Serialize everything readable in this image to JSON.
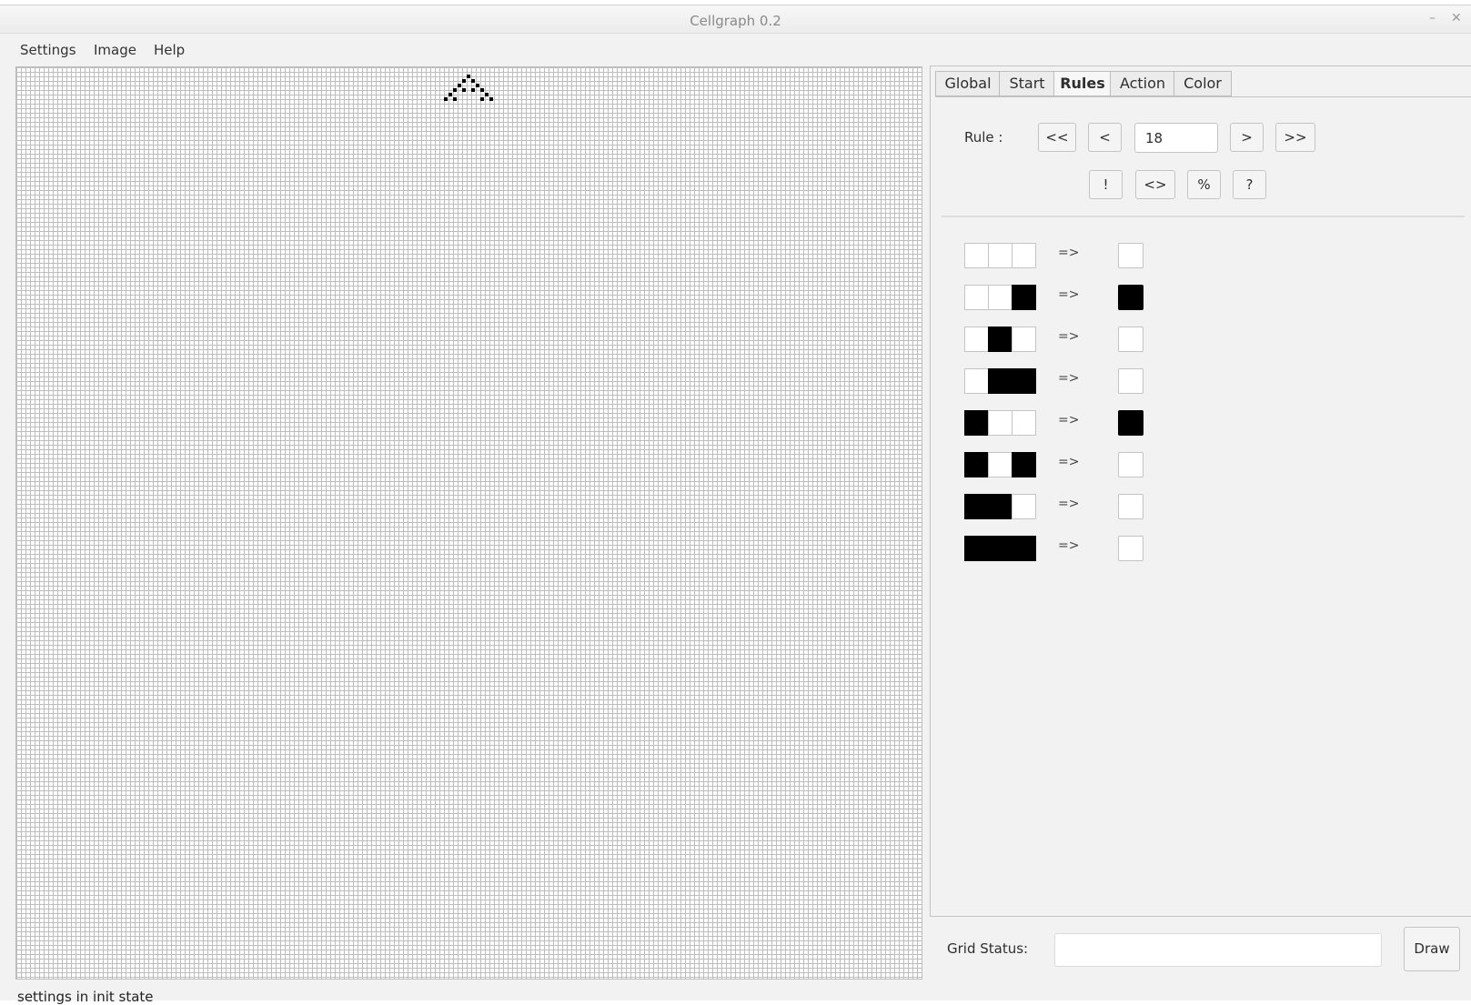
{
  "window": {
    "title": "Cellgraph 0.2",
    "minimize_glyph": "–",
    "close_glyph": "✕"
  },
  "menubar": {
    "items": [
      "Settings",
      "Image",
      "Help"
    ]
  },
  "tabs": [
    {
      "label": "Global",
      "active": false
    },
    {
      "label": "Start",
      "active": false
    },
    {
      "label": "Rules",
      "active": true
    },
    {
      "label": "Action",
      "active": false
    },
    {
      "label": "Color",
      "active": false
    }
  ],
  "rules": {
    "label": "Rule :",
    "value": "18",
    "nav_buttons": {
      "first": "<<",
      "prev": "<",
      "next": ">",
      "last": ">>"
    },
    "op_buttons": [
      "!",
      "<>",
      "%",
      "?"
    ],
    "arrow": "=>",
    "table": [
      {
        "pattern": [
          0,
          0,
          0
        ],
        "result": 0
      },
      {
        "pattern": [
          0,
          0,
          1
        ],
        "result": 1
      },
      {
        "pattern": [
          0,
          1,
          0
        ],
        "result": 0
      },
      {
        "pattern": [
          0,
          1,
          1
        ],
        "result": 0
      },
      {
        "pattern": [
          1,
          0,
          0
        ],
        "result": 1
      },
      {
        "pattern": [
          1,
          0,
          1
        ],
        "result": 0
      },
      {
        "pattern": [
          1,
          1,
          0
        ],
        "result": 0
      },
      {
        "pattern": [
          1,
          1,
          1
        ],
        "result": 0
      }
    ]
  },
  "grid": {
    "initial_state": "single center cell, rule 18 evolution shown for first rows",
    "live_rows": [
      [
        0
      ],
      [
        -1,
        1
      ],
      [
        -2,
        2
      ],
      [
        -3,
        -1,
        1,
        3
      ],
      [
        -4,
        4
      ],
      [
        -5,
        -3,
        3,
        5
      ]
    ]
  },
  "grid_status": {
    "label": "Grid Status:",
    "value": ""
  },
  "draw_button": "Draw",
  "status_bar": "settings in init state"
}
